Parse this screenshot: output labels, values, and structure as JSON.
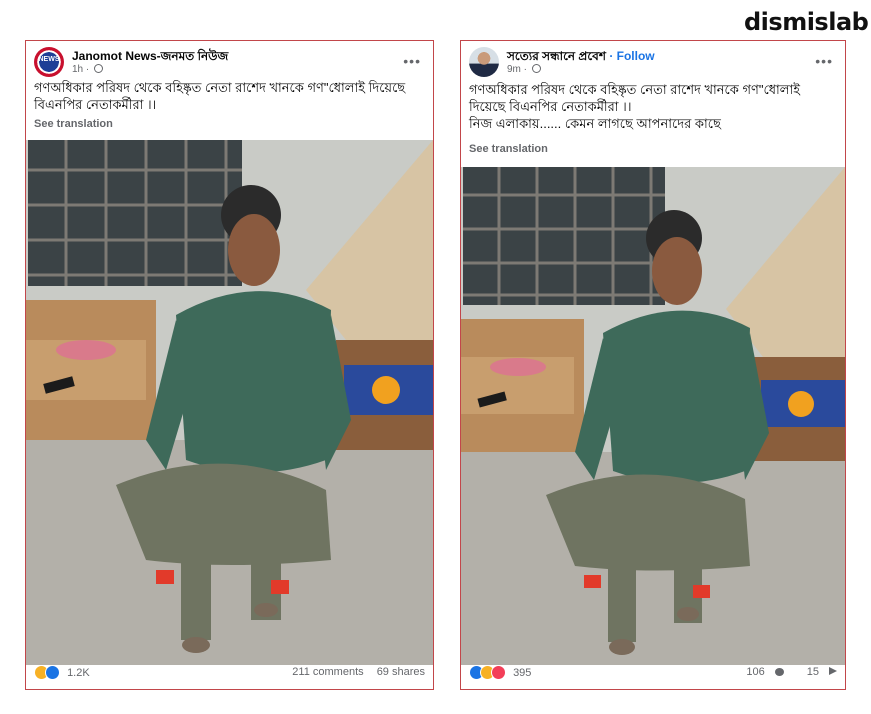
{
  "brand": "dismislab",
  "posts": [
    {
      "page_name": "Janomot News-জনমত নিউজ",
      "avatar_text": "NEWS",
      "time": "1h ·",
      "caption": "গণঅধিকার পরিষদ থেকে বহিষ্কৃত নেতা রাশেদ খানকে গণ\"ধোলাই দিয়েছে বিএনপির নেতাকর্মীরা ।।",
      "see_translation": "See translation",
      "reaction_count": "1.2K",
      "comments": "211 comments",
      "shares": "69 shares"
    },
    {
      "page_name": "সত্যের সন্ধানে প্রবেশ",
      "follow": "· Follow",
      "time": "9m ·",
      "caption_line1": "গণঅধিকার পরিষদ থেকে বহিষ্কৃত নেতা রাশেদ খানকে গণ\"ধোলাই দিয়েছে বিএনপির নেতাকর্মীরা ।।",
      "caption_line2": "নিজ এলাকায়......  কেমন লাগছে আপনাদের কাছে",
      "see_translation": "See translation",
      "reaction_count": "395",
      "comments": "106",
      "shares": "15"
    }
  ],
  "colors": {
    "card_border": "#c2464a",
    "follow": "#1b74e4",
    "meta_text": "#65676b"
  },
  "icons": [
    "more-icon",
    "globe-icon",
    "haha-icon",
    "like-icon",
    "love-icon",
    "comment-icon",
    "share-icon"
  ]
}
